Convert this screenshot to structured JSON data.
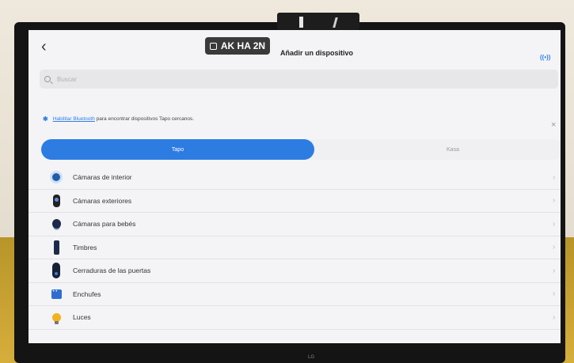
{
  "header": {
    "back_glyph": "‹",
    "badge_text": "AK HA 2N",
    "title": "Añadir un dispositivo",
    "signal_glyph": "((•))"
  },
  "search": {
    "placeholder": "Buscar"
  },
  "bluetooth_banner": {
    "bt_glyph": "✱",
    "link_text": "Habilitar Bluetooth",
    "text": "para encontrar dispositivos Tapo cercanos.",
    "close_glyph": "×"
  },
  "tabs": [
    {
      "label": "Tapo",
      "active": true
    },
    {
      "label": "Kasa",
      "active": false
    }
  ],
  "categories": [
    {
      "label": "Cámaras de interior",
      "icon": "indoor-camera-icon"
    },
    {
      "label": "Cámaras exteriores",
      "icon": "outdoor-camera-icon"
    },
    {
      "label": "Cámaras para bebés",
      "icon": "baby-camera-icon"
    },
    {
      "label": "Timbres",
      "icon": "doorbell-icon"
    },
    {
      "label": "Cerraduras de las puertas",
      "icon": "door-lock-icon"
    },
    {
      "label": "Enchufes",
      "icon": "smart-plug-icon"
    },
    {
      "label": "Luces",
      "icon": "light-bulb-icon"
    }
  ],
  "chevron_glyph": "›",
  "tv_brand": "LG",
  "colors": {
    "accent": "#2d7ce2",
    "screen_bg": "#f4f4f6",
    "badge_bg": "#3a3a3a"
  }
}
